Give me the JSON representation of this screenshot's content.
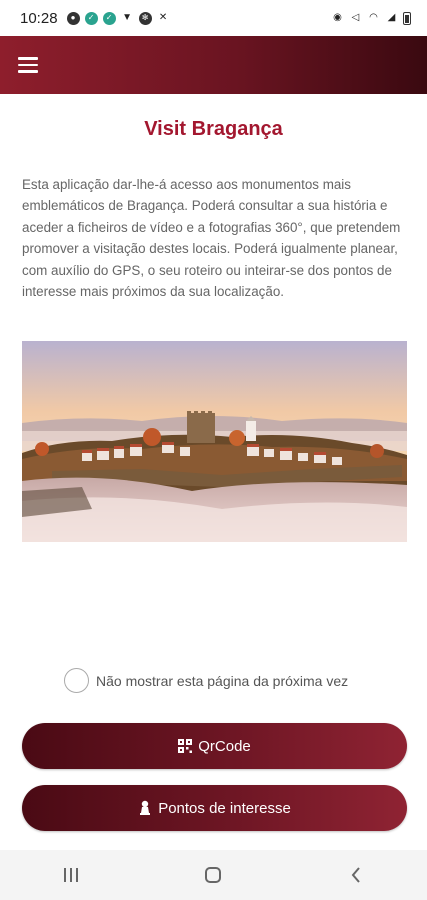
{
  "status_bar": {
    "time": "10:28"
  },
  "app_bar": {
    "menu_icon": "hamburger-menu-icon"
  },
  "page": {
    "title": "Visit Bragança",
    "intro": "Esta aplicação dar-lhe-á acesso aos monumentos mais emblemáticos de Bragança. Poderá consultar a sua história e aceder a ficheiros de vídeo e a fotografias 360°, que pretendem promover a visitação destes locais. Poderá igualmente planear, com auxílio do GPS, o seu roteiro ou inteirar-se dos pontos de interesse mais próximos da sua localização."
  },
  "option": {
    "label": "Não mostrar esta página da próxima vez",
    "checked": false
  },
  "buttons": {
    "qrcode": {
      "label": "QrCode",
      "icon": "qr-code-icon"
    },
    "poi": {
      "label": "Pontos de interesse",
      "icon": "map-pin-icon"
    }
  },
  "colors": {
    "accent": "#a3172f",
    "bar_dark": "#3a0910",
    "bar_light": "#8e1e2c"
  }
}
